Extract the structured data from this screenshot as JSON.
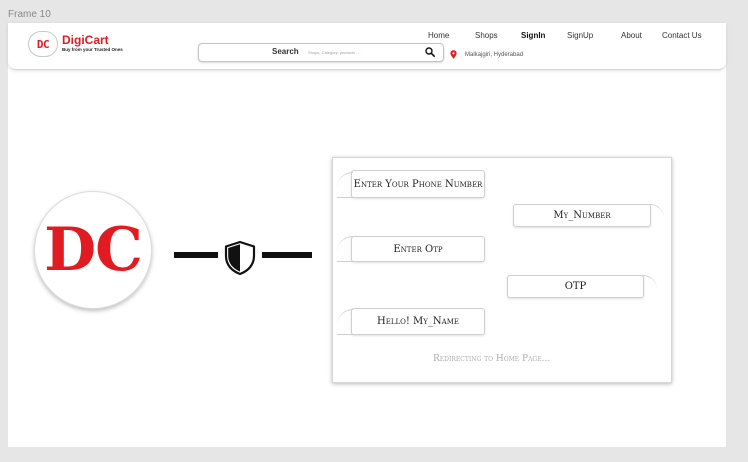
{
  "frame_label": "Frame 10",
  "brand": {
    "logo_text": "DC",
    "name": "DigiCart",
    "tagline": "Buy from your Trusted Ones",
    "colors": {
      "primary": "#e11b22"
    }
  },
  "search": {
    "label": "Search",
    "placeholder": "Shops, Category, products ....",
    "icon": "search-icon"
  },
  "location": {
    "icon": "map-pin-icon",
    "text": "Malkajgiri, Hyderabad"
  },
  "nav": [
    {
      "label": "Home",
      "active": false
    },
    {
      "label": "Shops",
      "active": false
    },
    {
      "label": "SignIn",
      "active": true
    },
    {
      "label": "SignUp",
      "active": false
    },
    {
      "label": "About",
      "active": false
    },
    {
      "label": "Contact Us",
      "active": false
    }
  ],
  "hero": {
    "logo_text": "DC",
    "connector_icon": "shield-icon"
  },
  "chat": {
    "messages": [
      {
        "side": "bot",
        "text": "Enter Your Phone Number"
      },
      {
        "side": "user",
        "text": "My_Number"
      },
      {
        "side": "bot",
        "text": "Enter Otp"
      },
      {
        "side": "user",
        "text": "OTP"
      },
      {
        "side": "bot",
        "text": "Hello!  My_Name"
      }
    ],
    "status": "Redirecting to Home Page..."
  }
}
